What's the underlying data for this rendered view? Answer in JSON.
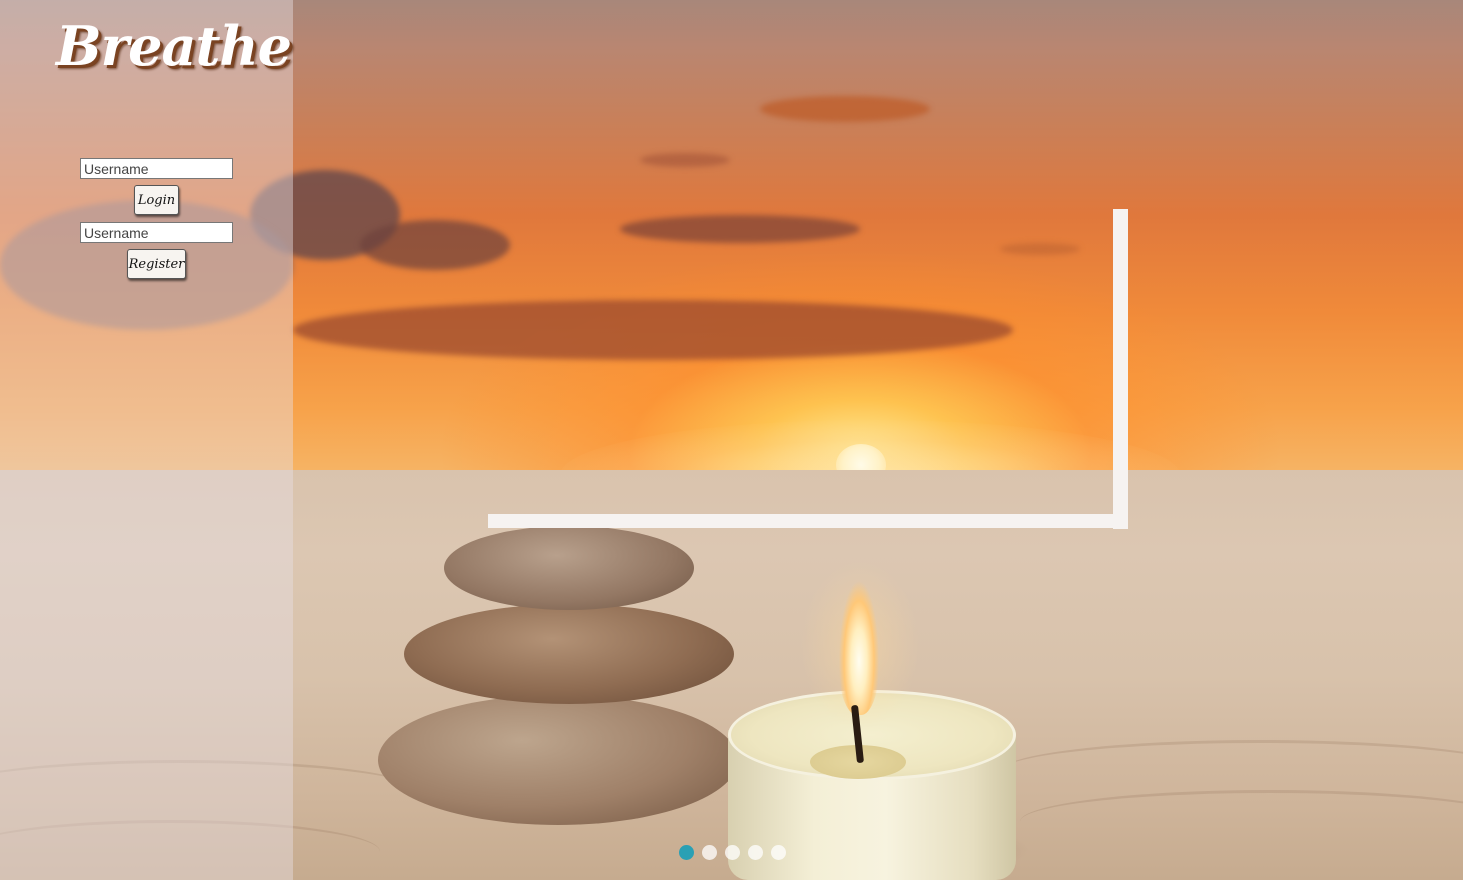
{
  "app": {
    "brand": "Breathe"
  },
  "login_form": {
    "username_placeholder": "Username",
    "login_label": "Login"
  },
  "register_form": {
    "username_placeholder": "Username",
    "register_label": "Register"
  },
  "carousel": {
    "slide_count": 5,
    "active_index": 0,
    "active_color": "#2aa0b4",
    "inactive_color": "#ffffff"
  },
  "scene": {
    "description_icons": [
      "stacked-stones",
      "tea-light-candle",
      "sunset"
    ]
  }
}
